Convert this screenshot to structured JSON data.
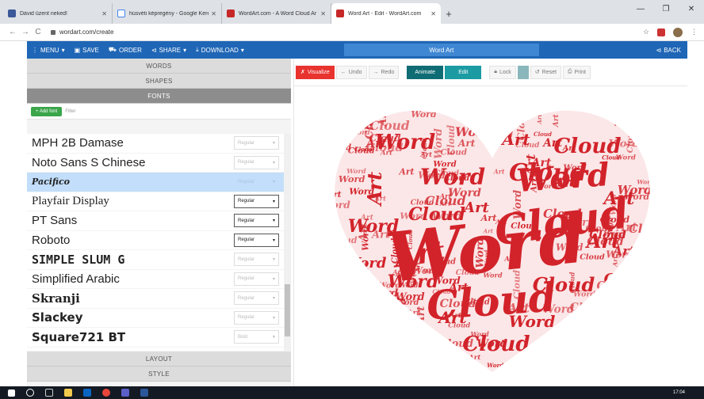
{
  "browser": {
    "tabs": [
      {
        "title": "Dávid üzent neked!",
        "color": "#3b5998"
      },
      {
        "title": "húsvéti képregény - Google Kere",
        "color": "#4285f4"
      },
      {
        "title": "WordArt.com - A Word Cloud Ar",
        "color": "#c62828"
      },
      {
        "title": "Word Art - Edit - WordArt.com",
        "color": "#c62828"
      }
    ],
    "url": "wordart.com/create"
  },
  "nav": {
    "menu": "MENU",
    "save": "SAVE",
    "order": "ORDER",
    "share": "SHARE",
    "download": "DOWNLOAD",
    "title": "Word Art",
    "back": "BACK"
  },
  "sections": {
    "words": "WORDS",
    "shapes": "SHAPES",
    "fonts": "FONTS",
    "layout": "LAYOUT",
    "style": "STYLE"
  },
  "fontbar": {
    "add": "Add font",
    "filter": "Filter"
  },
  "fonts": [
    {
      "name": "MPH 2B Damase",
      "weight": "Regular",
      "active": false,
      "family": "\"Liberation Sans\", sans-serif",
      "style": "normal",
      "bold": false
    },
    {
      "name": "Noto Sans S Chinese",
      "weight": "Regular",
      "active": false,
      "family": "\"Liberation Sans\", sans-serif",
      "style": "normal",
      "bold": false
    },
    {
      "name": "Pacifico",
      "weight": "Regular",
      "active": false,
      "family": "\"DejaVu Serif\", serif",
      "style": "italic",
      "bold": true
    },
    {
      "name": "Playfair Display",
      "weight": "Regular",
      "active": true,
      "family": "\"Liberation Serif\", serif",
      "style": "normal",
      "bold": false
    },
    {
      "name": "PT Sans",
      "weight": "Regular",
      "active": true,
      "family": "\"Liberation Sans\", sans-serif",
      "style": "normal",
      "bold": false
    },
    {
      "name": "Roboto",
      "weight": "Regular",
      "active": true,
      "family": "\"Liberation Sans\", sans-serif",
      "style": "normal",
      "bold": false
    },
    {
      "name": "SIMPLE SLUM G",
      "weight": "Regular",
      "active": false,
      "family": "\"DejaVu Sans Mono\", monospace",
      "style": "normal",
      "bold": true
    },
    {
      "name": "Simplified Arabic",
      "weight": "Regular",
      "active": false,
      "family": "\"Liberation Sans\", sans-serif",
      "style": "normal",
      "bold": false
    },
    {
      "name": "Skranji",
      "weight": "Regular",
      "active": false,
      "family": "\"DejaVu Serif\", serif",
      "style": "normal",
      "bold": true
    },
    {
      "name": "Slackey",
      "weight": "Regular",
      "active": false,
      "family": "\"DejaVu Sans\", sans-serif",
      "style": "normal",
      "bold": true
    },
    {
      "name": "Square721 BT",
      "weight": "Bold",
      "active": false,
      "family": "\"DejaVu Sans\", sans-serif",
      "style": "normal",
      "bold": true
    }
  ],
  "selected_font": "Pacifico",
  "toolbar": {
    "visualize": "Visualize",
    "undo": "Undo",
    "redo": "Redo",
    "animate": "Animate",
    "edit": "Edit",
    "lock": "Lock",
    "reset": "Reset",
    "print": "Print"
  },
  "cloud_words": [
    "Word",
    "Cloud",
    "Art"
  ],
  "cloud_color": "#d2232a",
  "taskbar": {
    "time": "17:04"
  }
}
